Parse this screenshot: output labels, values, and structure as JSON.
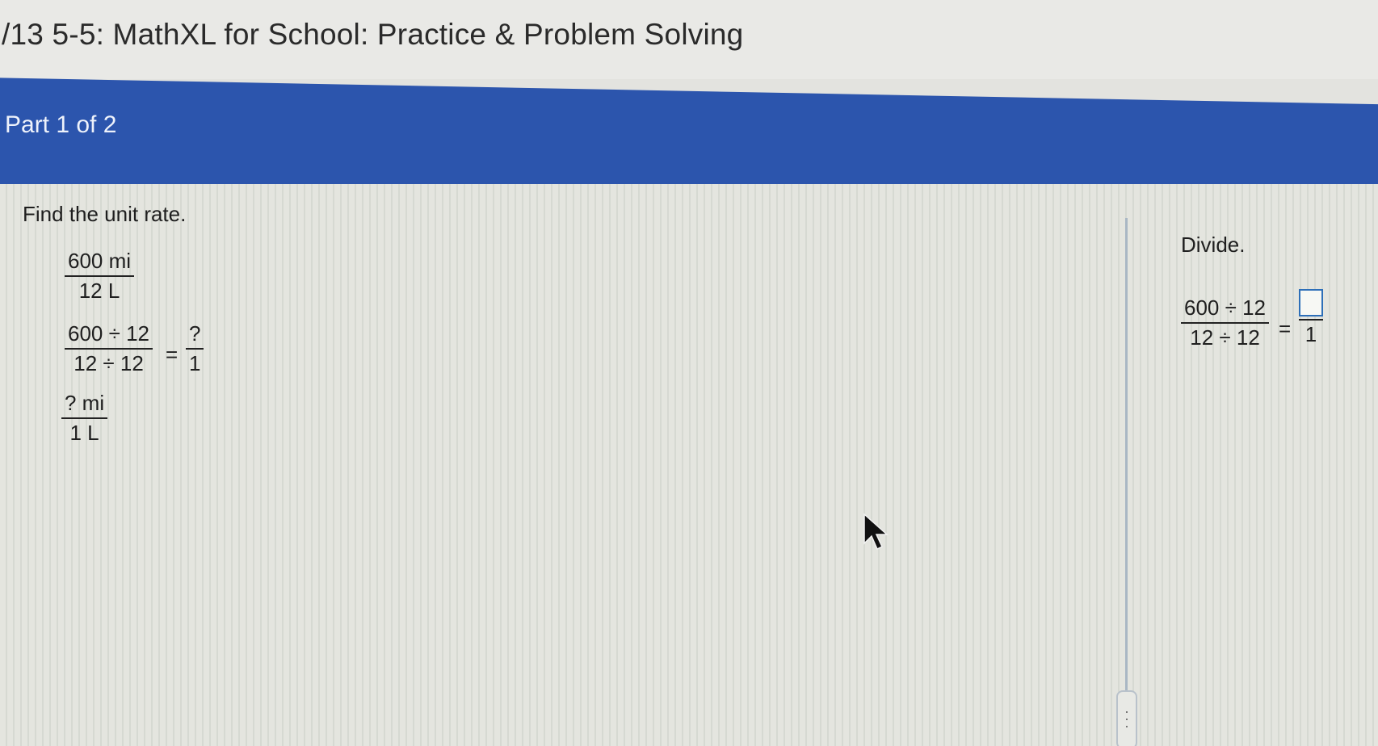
{
  "header": {
    "title": "/13 5-5: MathXL for School: Practice & Problem Solving"
  },
  "part": {
    "label": "Part 1 of 2"
  },
  "left_panel": {
    "instruction": "Find the unit rate.",
    "given": {
      "numerator": "600 mi",
      "denominator": "12 L"
    },
    "step": {
      "numerator": "600 ÷ 12",
      "denominator": "12 ÷ 12",
      "equals": "=",
      "result_numerator": "?",
      "result_denominator": "1"
    },
    "result": {
      "numerator": "? mi",
      "denominator": "1 L"
    }
  },
  "right_panel": {
    "instruction": "Divide.",
    "expression": {
      "numerator": "600 ÷ 12",
      "denominator": "12 ÷ 12",
      "equals": "=",
      "answer_value": "",
      "answer_denominator": "1"
    }
  },
  "icons": {
    "cursor": "mouse-pointer-icon",
    "handle": "resize-handle-icon"
  },
  "colors": {
    "part_bar": "#2c55ad",
    "answer_box_border": "#2d6fb8"
  }
}
